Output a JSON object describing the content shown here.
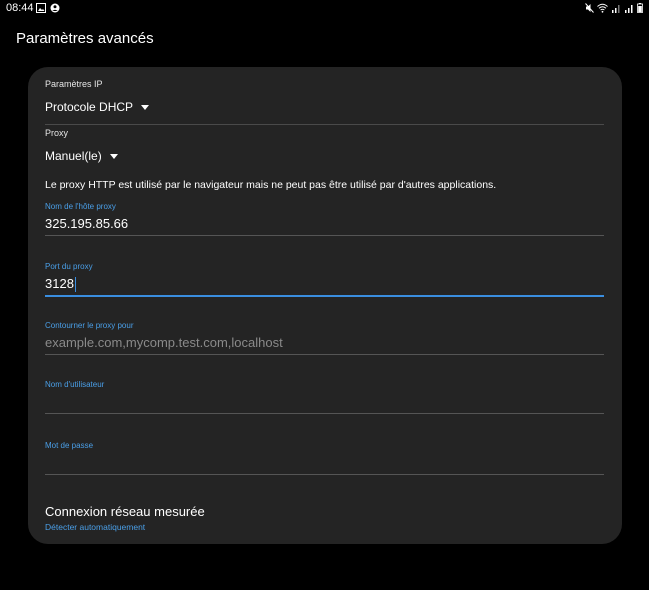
{
  "status_bar": {
    "time": "08:44"
  },
  "page": {
    "title": "Paramètres avancés"
  },
  "ip_settings": {
    "label": "Paramètres IP",
    "value": "Protocole DHCP"
  },
  "proxy": {
    "label": "Proxy",
    "value": "Manuel(le)",
    "info": "Le proxy HTTP est utilisé par le navigateur mais ne peut pas être utilisé par d'autres applications."
  },
  "fields": {
    "host": {
      "label": "Nom de l'hôte proxy",
      "value": "325.195.85.66"
    },
    "port": {
      "label": "Port du proxy",
      "value": "3128"
    },
    "bypass": {
      "label": "Contourner le proxy pour",
      "placeholder": "example.com,mycomp.test.com,localhost"
    },
    "username": {
      "label": "Nom d'utilisateur",
      "value": ""
    },
    "password": {
      "label": "Mot de passe",
      "value": ""
    }
  },
  "metered": {
    "title": "Connexion réseau mesurée",
    "subtitle": "Détecter automatiquement"
  },
  "colors": {
    "background": "#000000",
    "card": "#242424",
    "accent": "#3a8ee0",
    "label_accent": "#4a9fe8"
  }
}
